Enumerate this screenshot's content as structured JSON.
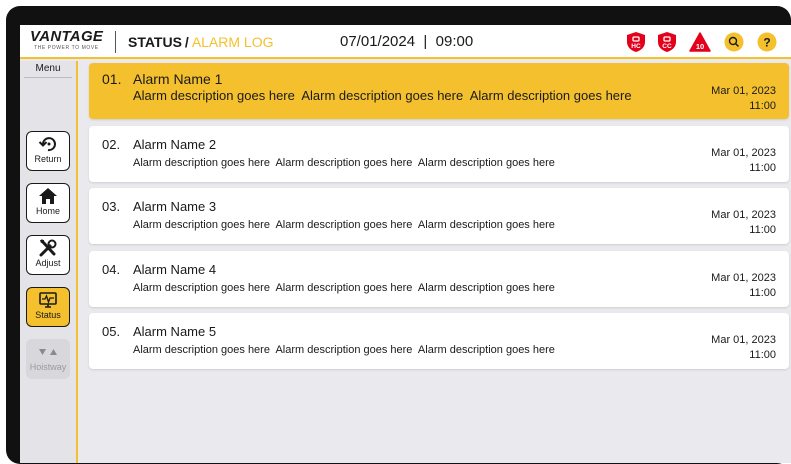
{
  "header": {
    "logo_text": "VANTAGE",
    "logo_tagline": "THE POWER TO MOVE",
    "breadcrumb_section": "STATUS",
    "breadcrumb_separator": "/",
    "breadcrumb_current": "ALARM LOG",
    "datetime": "07/01/2024  |  09:00",
    "icons": [
      {
        "name": "hc-lock-icon",
        "label": "HC"
      },
      {
        "name": "cc-lock-icon",
        "label": "CC"
      },
      {
        "name": "alarm-warning-icon",
        "label": "10"
      },
      {
        "name": "search-icon",
        "label": ""
      },
      {
        "name": "help-icon",
        "label": "?"
      }
    ],
    "accent_color": "#f5c02e",
    "alert_color": "#e3001b"
  },
  "sidebar": {
    "menu_label": "Menu",
    "items": [
      {
        "label": "Return",
        "icon": "return-icon",
        "state": "normal"
      },
      {
        "label": "Home",
        "icon": "home-icon",
        "state": "normal"
      },
      {
        "label": "Adjust",
        "icon": "tools-icon",
        "state": "normal"
      },
      {
        "label": "Status",
        "icon": "monitor-icon",
        "state": "active"
      },
      {
        "label": "Hoistway",
        "icon": "hoistway-icon",
        "state": "disabled"
      }
    ]
  },
  "alarms": [
    {
      "num": "01.",
      "name": "Alarm Name 1",
      "desc": "Alarm description goes here  Alarm description goes here  Alarm description goes here",
      "date": "Mar 01, 2023",
      "time": "11:00",
      "selected": true
    },
    {
      "num": "02.",
      "name": "Alarm Name 2",
      "desc": "Alarm description goes here  Alarm description goes here  Alarm description goes here",
      "date": "Mar 01, 2023",
      "time": "11:00",
      "selected": false
    },
    {
      "num": "03.",
      "name": "Alarm Name 3",
      "desc": "Alarm description goes here  Alarm description goes here  Alarm description goes here",
      "date": "Mar 01, 2023",
      "time": "11:00",
      "selected": false
    },
    {
      "num": "04.",
      "name": "Alarm Name 4",
      "desc": "Alarm description goes here  Alarm description goes here  Alarm description goes here",
      "date": "Mar 01, 2023",
      "time": "11:00",
      "selected": false
    },
    {
      "num": "05.",
      "name": "Alarm Name 5",
      "desc": "Alarm description goes here  Alarm description goes here  Alarm description goes here",
      "date": "Mar 01, 2023",
      "time": "11:00",
      "selected": false
    }
  ]
}
